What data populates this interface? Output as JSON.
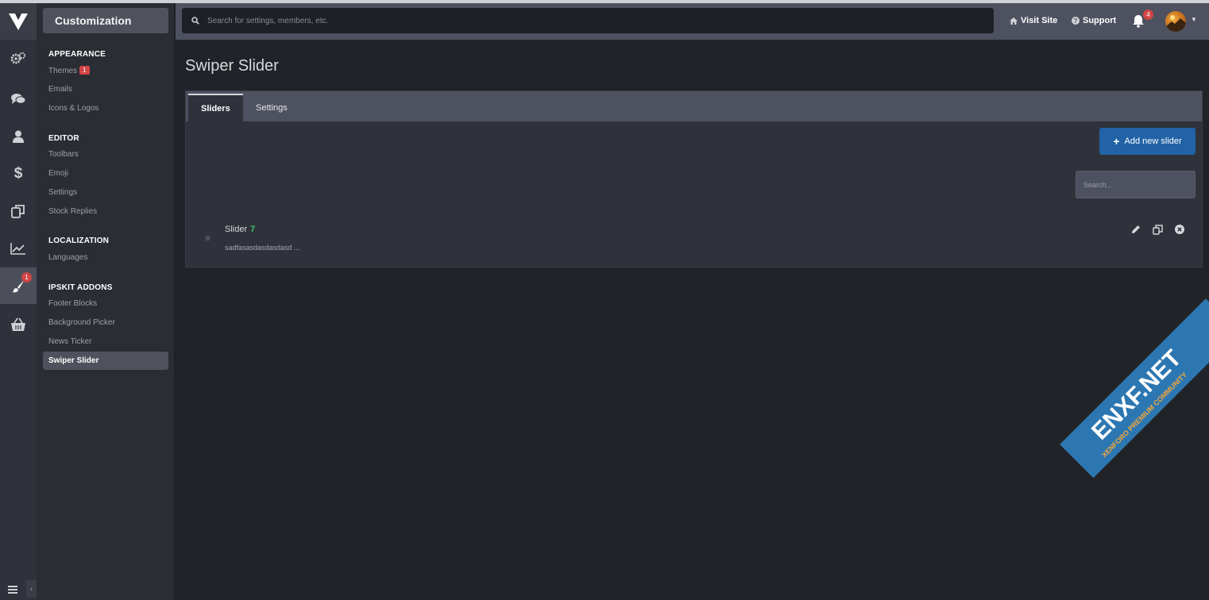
{
  "sidebar_header": "Customization",
  "sidebar_groups": [
    {
      "title": "APPEARANCE",
      "links": [
        "Themes",
        "Emails",
        "Icons & Logos"
      ]
    },
    {
      "title": "EDITOR",
      "links": [
        "Toolbars",
        "Emoji",
        "Settings",
        "Stock Replies"
      ]
    },
    {
      "title": "LOCALIZATION",
      "links": [
        "Languages"
      ]
    },
    {
      "title": "IPSKIT ADDONS",
      "links": [
        "Footer Blocks",
        "Background Picker",
        "News Ticker",
        "Swiper Slider"
      ]
    }
  ],
  "themes_badge": "1",
  "rail": {
    "icons": [
      "logo-icon",
      "gears-icon",
      "comments-icon",
      "user-icon",
      "dollar-icon",
      "copy-icon",
      "chart-icon",
      "brush-icon",
      "basket-icon"
    ],
    "active": "brush-icon",
    "brush_badge": "1"
  },
  "topbar": {
    "search_placeholder": "Search for settings, members, etc.",
    "visit_site": "Visit Site",
    "support": "Support",
    "notifications_count": "4"
  },
  "page": {
    "title": "Swiper Slider",
    "tabs": [
      "Sliders",
      "Settings"
    ],
    "active_tab": "Sliders",
    "add_button": "Add new slider",
    "filter_placeholder": "Search...",
    "slider": {
      "title": "Slider",
      "count": "7",
      "description": "sadfasasdasdasdasd ..."
    }
  },
  "watermark": {
    "line1": "ENXF.NET",
    "line2": "XENFORO PREMIUM COMMUNITY"
  },
  "colors": {
    "accent": "#2163a6",
    "badge": "#d14545",
    "count": "#47c26b"
  }
}
